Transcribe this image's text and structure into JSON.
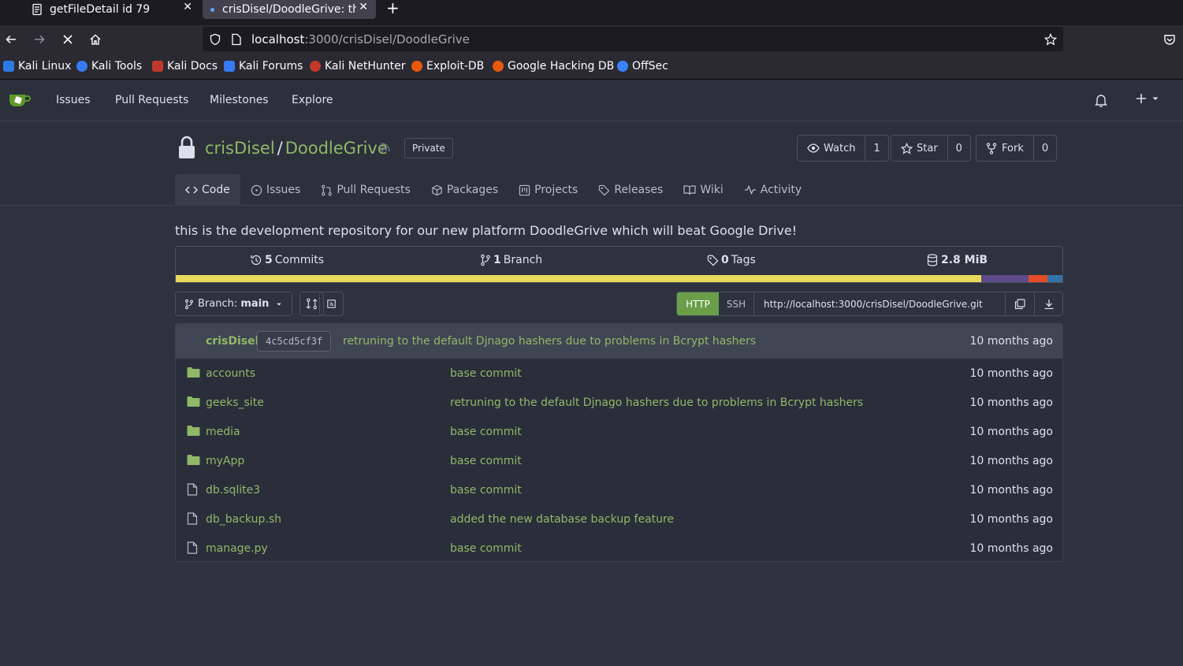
{
  "browser": {
    "tabs": [
      {
        "title": "getFileDetail id 79"
      },
      {
        "title": "crisDisel/DoodleGrive: thi"
      }
    ],
    "url_host": "localhost",
    "url_path": ":3000/crisDisel/DoodleGrive",
    "bookmarks": [
      {
        "label": "Kali Linux",
        "color": "#2c7be5"
      },
      {
        "label": "Kali Tools",
        "color": "#367bf0"
      },
      {
        "label": "Kali Docs",
        "color": "#c0392b"
      },
      {
        "label": "Kali Forums",
        "color": "#367bf0"
      },
      {
        "label": "Kali NetHunter",
        "color": "#c0392b"
      },
      {
        "label": "Exploit-DB",
        "color": "#e8590c"
      },
      {
        "label": "Google Hacking DB",
        "color": "#e8590c"
      },
      {
        "label": "OffSec",
        "color": "#3b82f6"
      }
    ]
  },
  "gitea": {
    "nav": [
      "Issues",
      "Pull Requests",
      "Milestones",
      "Explore"
    ]
  },
  "repo": {
    "owner": "crisDisel",
    "separator": "/",
    "name": "DoodleGrive",
    "visibility": "Private",
    "watch_label": "Watch",
    "watch_count": "1",
    "star_label": "Star",
    "star_count": "0",
    "fork_label": "Fork",
    "fork_count": "0",
    "tabs": [
      "Code",
      "Issues",
      "Pull Requests",
      "Packages",
      "Projects",
      "Releases",
      "Wiki",
      "Activity"
    ],
    "description": "this is the development repository for our new platform DoodleGrive which will beat Google Drive!",
    "stats": {
      "commits_num": "5",
      "commits_label": "Commits",
      "branch_num": "1",
      "branch_label": "Branch",
      "tags_num": "0",
      "tags_label": "Tags",
      "size": "2.8 MiB"
    },
    "languages": [
      {
        "color": "#e8d95a",
        "fraction": 0.908
      },
      {
        "color": "#5d4a8a",
        "fraction": 0.054
      },
      {
        "color": "#e34c26",
        "fraction": 0.021
      },
      {
        "color": "#3572a5",
        "fraction": 0.017
      }
    ],
    "branch_prefix": "Branch:",
    "branch_name": "main",
    "clone": {
      "http": "HTTP",
      "ssh": "SSH",
      "url": "http://localhost:3000/crisDisel/DoodleGrive.git"
    },
    "latest_commit": {
      "author": "crisDisel",
      "sha": "4c5cd5cf3f",
      "message": "retruning to the default Djnago hashers due to problems in Bcrypt hashers",
      "time": "10 months ago"
    },
    "files": [
      {
        "name": "accounts",
        "type": "folder",
        "message": "base commit",
        "time": "10 months ago"
      },
      {
        "name": "geeks_site",
        "type": "folder",
        "message": "retruning to the default Djnago hashers due to problems in Bcrypt hashers",
        "time": "10 months ago"
      },
      {
        "name": "media",
        "type": "folder",
        "message": "base commit",
        "time": "10 months ago"
      },
      {
        "name": "myApp",
        "type": "folder",
        "message": "base commit",
        "time": "10 months ago"
      },
      {
        "name": "db.sqlite3",
        "type": "file",
        "message": "base commit",
        "time": "10 months ago"
      },
      {
        "name": "db_backup.sh",
        "type": "file",
        "message": "added the new database backup feature",
        "time": "10 months ago"
      },
      {
        "name": "manage.py",
        "type": "file",
        "message": "base commit",
        "time": "10 months ago"
      }
    ]
  }
}
